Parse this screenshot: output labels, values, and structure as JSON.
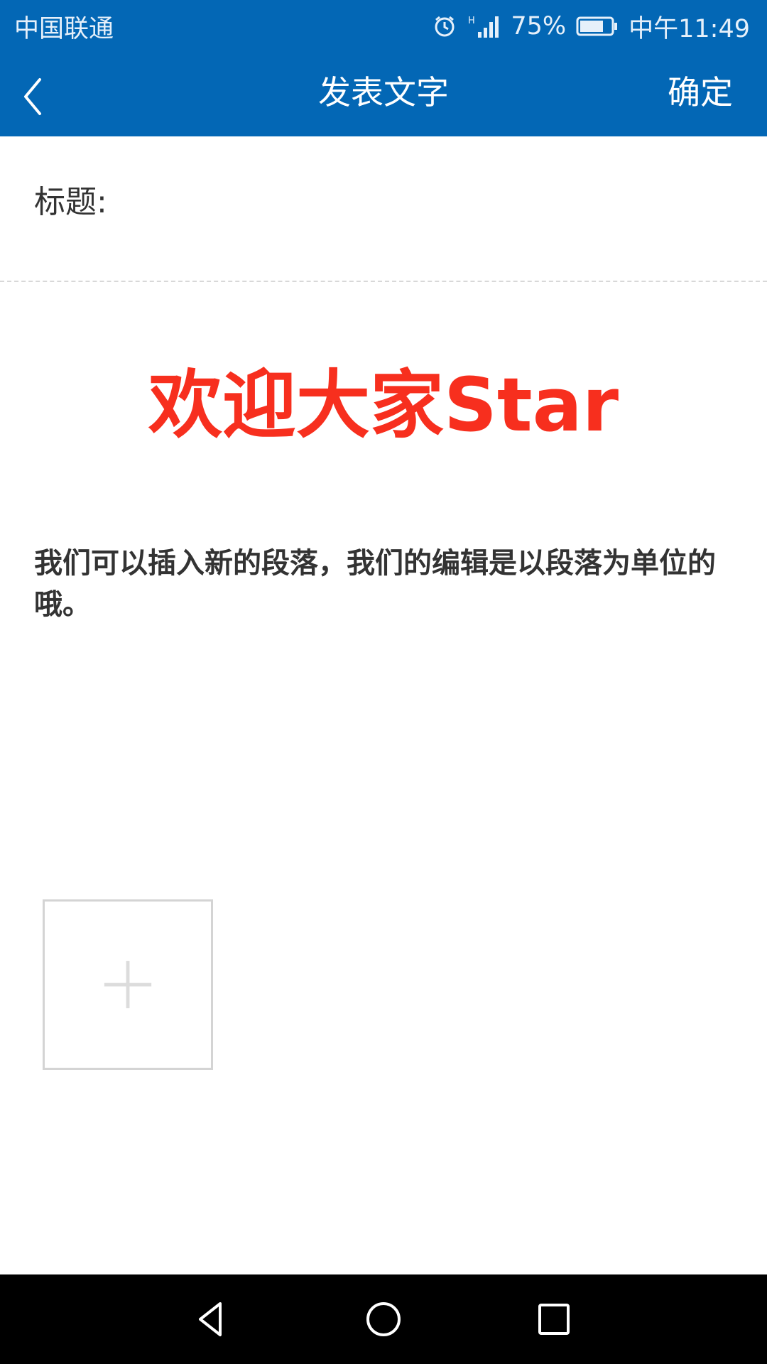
{
  "status_bar": {
    "carrier": "中国联通",
    "battery_percent": "75%",
    "time": "中午11:49",
    "network": "H",
    "icons": [
      "alarm-icon",
      "signal-icon",
      "battery-icon"
    ]
  },
  "app_bar": {
    "title": "发表文字",
    "confirm_label": "确定",
    "back_icon": "chevron-left-icon"
  },
  "form": {
    "title_label": "标题:",
    "title_value": ""
  },
  "content": {
    "heading": "欢迎大家Star",
    "paragraph": "我们可以插入新的段落，我们的编辑是以段落为单位的哦。"
  },
  "add_image": {
    "icon": "plus-icon"
  },
  "nav_bar": {
    "icons": [
      "nav-back-icon",
      "nav-home-icon",
      "nav-recent-icon"
    ]
  },
  "colors": {
    "primary": "#0367b5",
    "heading_red": "#f72f1e",
    "text": "#333333"
  }
}
